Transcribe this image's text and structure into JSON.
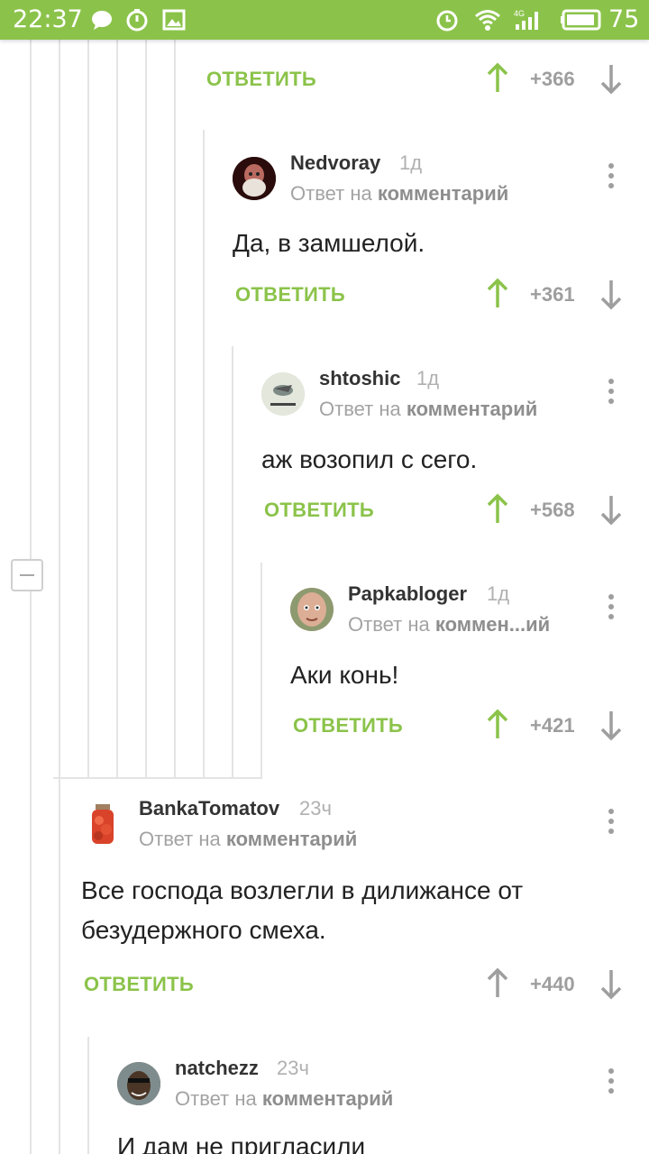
{
  "status_bar": {
    "time": "22:37",
    "battery": "75",
    "network": "4G"
  },
  "reply_label": "ОТВЕТИТЬ",
  "reply_to_prefix": "Ответ на",
  "reply_to_target": "комментарий",
  "reply_to_target_short": "коммен...ий",
  "colors": {
    "accent": "#8bc34a",
    "score": "#9e9e9e"
  },
  "comments": [
    {
      "score": "+366"
    },
    {
      "user": "Nedvoray",
      "age": "1д",
      "text": "Да, в замшелой.",
      "score": "+361"
    },
    {
      "user": "shtoshic",
      "age": "1д",
      "text": "аж возопил с сего.",
      "score": "+568"
    },
    {
      "user": "Papkabloger",
      "age": "1д",
      "text": "Аки конь!",
      "score": "+421"
    },
    {
      "user": "BankaTomatov",
      "age": "23ч",
      "text": "Все господа возлегли в дилижансе от безудержного смеха.",
      "score": "+440"
    },
    {
      "user": "natchezz",
      "age": "23ч",
      "text": "И дам не пригласили"
    }
  ]
}
